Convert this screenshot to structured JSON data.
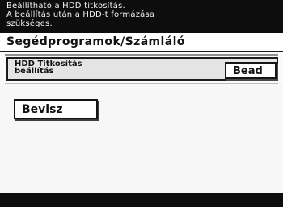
{
  "header": {
    "line1": "Beállítható a HDD titkosítás.",
    "line2": "A beállítás után a HDD-t formázása",
    "line3": "szükséges."
  },
  "breadcrumb": "Segédprogramok/Számláló",
  "setting": {
    "label_line1": "HDD Titkosítás",
    "label_line2": "beállítás",
    "value": "Bead"
  },
  "enter_button": "Bevisz"
}
